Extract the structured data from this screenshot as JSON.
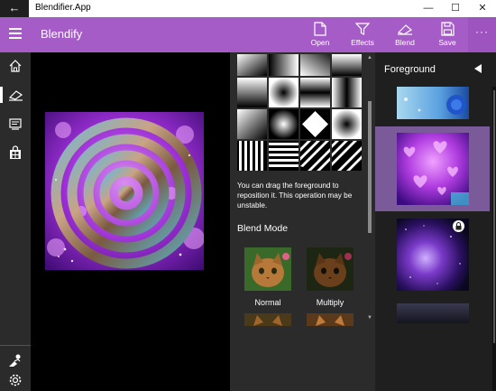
{
  "window": {
    "title": "Blendifier.App",
    "back_glyph": "←",
    "minimize_glyph": "—",
    "maximize_glyph": "☐",
    "close_glyph": "✕"
  },
  "header": {
    "app_title": "Blendify",
    "accent_color": "#a65cc7",
    "commands": [
      {
        "label": "Open",
        "icon": "open-file-icon"
      },
      {
        "label": "Effects",
        "icon": "filter-icon"
      },
      {
        "label": "Blend",
        "icon": "blend-icon"
      },
      {
        "label": "Save",
        "icon": "save-icon"
      }
    ],
    "more_glyph": "···"
  },
  "navrail": {
    "items": [
      {
        "icon": "home-icon",
        "selected": false
      },
      {
        "icon": "blend-icon",
        "selected": true
      },
      {
        "icon": "gallery-icon",
        "selected": false
      },
      {
        "icon": "store-icon",
        "selected": false
      }
    ],
    "bottom_items": [
      {
        "icon": "account-icon"
      },
      {
        "icon": "settings-icon"
      }
    ]
  },
  "mask_panel": {
    "hint_text": "You can drag the foreground to reposition it. This operation may be unstable.",
    "blend_mode_heading": "Blend Mode",
    "blend_modes": [
      {
        "label": "Normal"
      },
      {
        "label": "Multiply"
      }
    ]
  },
  "foreground_panel": {
    "title": "Foreground",
    "items": [
      {
        "name": "blue-rose",
        "selected": false,
        "locked": false
      },
      {
        "name": "purple-hearts",
        "selected": true,
        "locked": false
      },
      {
        "name": "galaxy",
        "selected": false,
        "locked": true
      }
    ]
  }
}
